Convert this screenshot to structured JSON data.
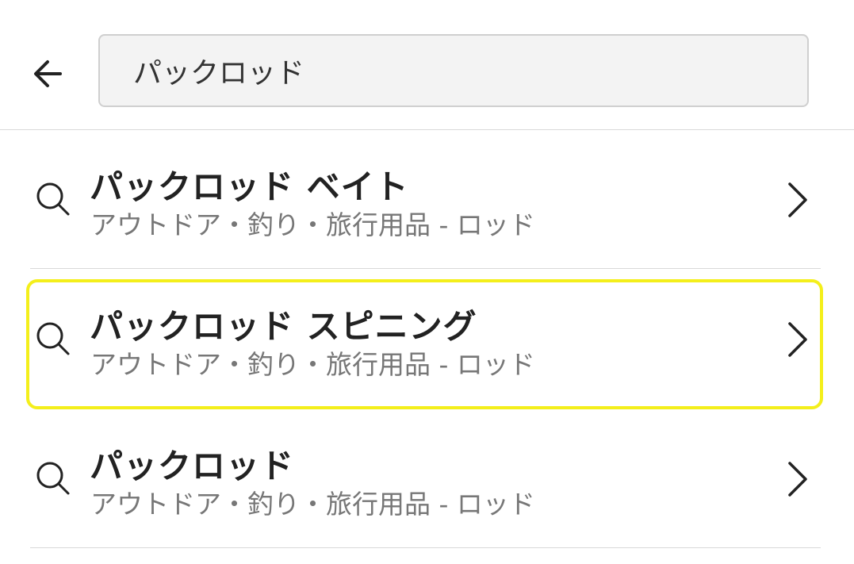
{
  "header": {
    "back_icon": "arrow-left-icon",
    "search_value": "パックロッド"
  },
  "suggestions": [
    {
      "title": "パックロッド ベイト",
      "category": "アウトドア・釣り・旅行用品 - ロッド",
      "highlighted": false
    },
    {
      "title": "パックロッド スピニング",
      "category": "アウトドア・釣り・旅行用品 - ロッド",
      "highlighted": true
    },
    {
      "title": "パックロッド",
      "category": "アウトドア・釣り・旅行用品 - ロッド",
      "highlighted": false
    }
  ],
  "colors": {
    "highlight": "#f4ef1b",
    "divider": "#d9d9d9",
    "subtitle": "#777777"
  }
}
